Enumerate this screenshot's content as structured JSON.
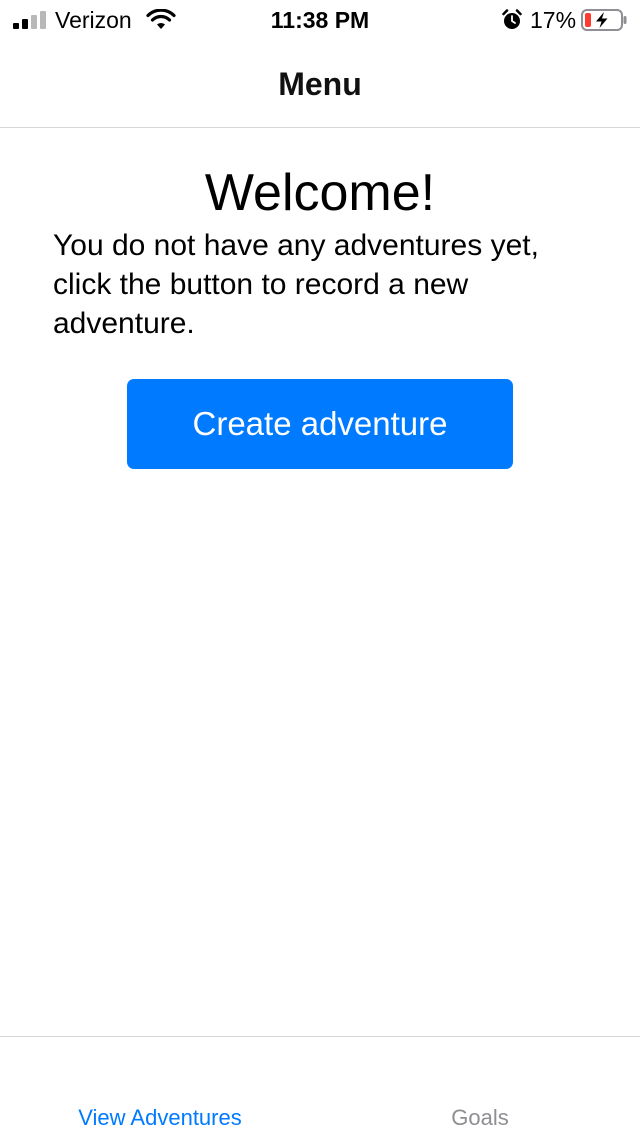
{
  "status_bar": {
    "carrier": "Verizon",
    "time": "11:38 PM",
    "battery_percent": "17%",
    "icons": [
      "signal-icon",
      "wifi-icon",
      "alarm-icon",
      "battery-charging-icon"
    ],
    "battery_level": 0.17,
    "battery_color": "#ff3b30"
  },
  "nav": {
    "title": "Menu"
  },
  "main": {
    "heading": "Welcome!",
    "message": "You do not have any adventures yet, click the button to record a new adventure.",
    "create_button_label": "Create adventure"
  },
  "tab_bar": {
    "tabs": [
      {
        "label": "View Adventures",
        "active": true
      },
      {
        "label": "Goals",
        "active": false
      }
    ]
  },
  "colors": {
    "accent": "#007aff",
    "inactive_tab": "#8e8e93",
    "divider": "#d8d8d8"
  }
}
